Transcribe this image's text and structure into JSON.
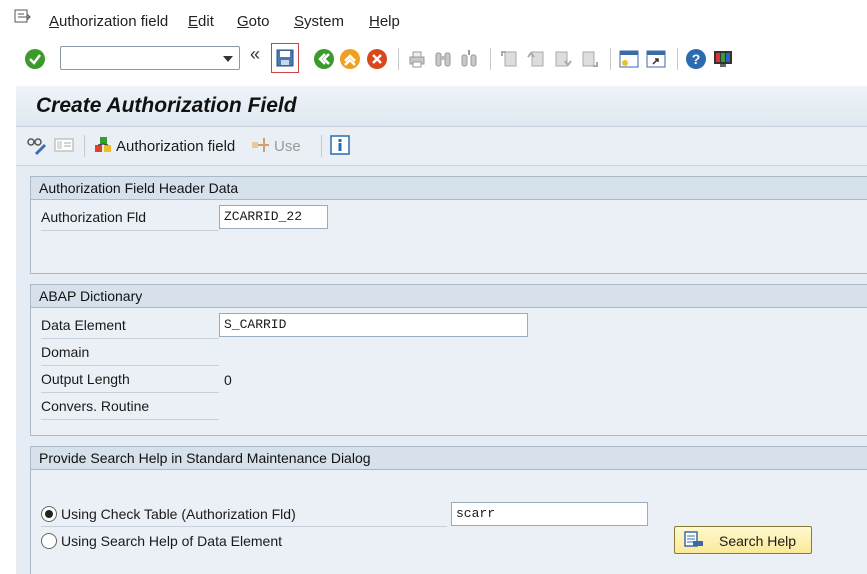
{
  "menu": {
    "items": [
      {
        "label": "Authorization field",
        "underline": "A",
        "rest": "uthorization field"
      },
      {
        "label": "Edit",
        "underline": "E",
        "rest": "dit"
      },
      {
        "label": "Goto",
        "underline": "G",
        "rest": "oto"
      },
      {
        "label": "System",
        "underline": "S",
        "rest": "ystem"
      },
      {
        "label": "Help",
        "underline": "H",
        "rest": "elp"
      }
    ]
  },
  "toolbar": {
    "command_value": "",
    "collapse_glyph": "«"
  },
  "title": "Create Authorization Field",
  "app_toolbar": {
    "authorization_field_label": "Authorization field",
    "use_label": "Use"
  },
  "header_group": {
    "title": "Authorization Field Header Data",
    "auth_fld_label": "Authorization Fld",
    "auth_fld_value": "ZCARRID_22"
  },
  "dict_group": {
    "title": "ABAP Dictionary",
    "data_element_label": "Data Element",
    "data_element_value": "S_CARRID",
    "domain_label": "Domain",
    "output_length_label": "Output Length",
    "output_length_value": "0",
    "convers_routine_label": "Convers. Routine"
  },
  "search_group": {
    "title": "Provide Search Help in Standard Maintenance Dialog",
    "radio_check_table_label": "Using Check Table (Authorization Fld)",
    "radio_check_table_selected": true,
    "check_table_value": "scarr",
    "radio_search_help_label": "Using Search Help of Data Element",
    "search_help_button_label": "Search Help"
  },
  "colors": {
    "accent_green": "#3a9a2a",
    "help_blue": "#2b6cb0",
    "button_yellow": "#fbe99a"
  }
}
